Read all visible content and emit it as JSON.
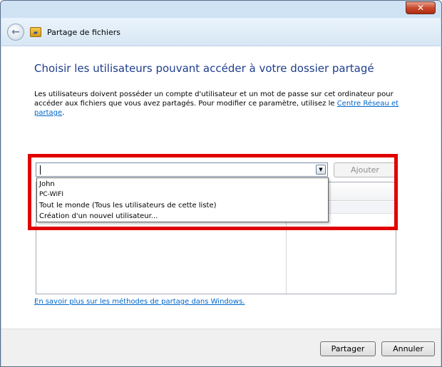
{
  "window": {
    "close_glyph": "✕",
    "back_glyph": "←",
    "title": "Partage de fichiers"
  },
  "page": {
    "heading": "Choisir les utilisateurs pouvant accéder à votre dossier partagé",
    "description_text": "Les utilisateurs doivent posséder un compte d'utilisateur et un mot de passe sur cet ordinateur pour accéder aux fichiers que vous avez partagés. Pour modifier ce paramètre, utilisez le ",
    "description_link": "Centre Réseau et partage",
    "description_end": "."
  },
  "user_picker": {
    "input_value": "",
    "add_button_label": "Ajouter",
    "dropdown_arrow_glyph": "▼",
    "options": [
      "John",
      "PC-WIFI",
      "Tout le monde (Tous les utilisateurs de cette liste)",
      "Création d'un nouvel utilisateur..."
    ]
  },
  "table": {
    "permission_header_visible": "torisation",
    "permission_row_visible": "▼"
  },
  "links": {
    "learn_more": "En savoir plus sur les méthodes de partage dans Windows."
  },
  "footer": {
    "share_label": "Partager",
    "cancel_label": "Annuler"
  },
  "colors": {
    "heading": "#1e3d8c",
    "link": "#0066cc",
    "highlight_border": "#e00000"
  },
  "icons": {
    "back": "back-arrow-icon",
    "wizard": "file-sharing-icon",
    "close": "close-icon"
  }
}
